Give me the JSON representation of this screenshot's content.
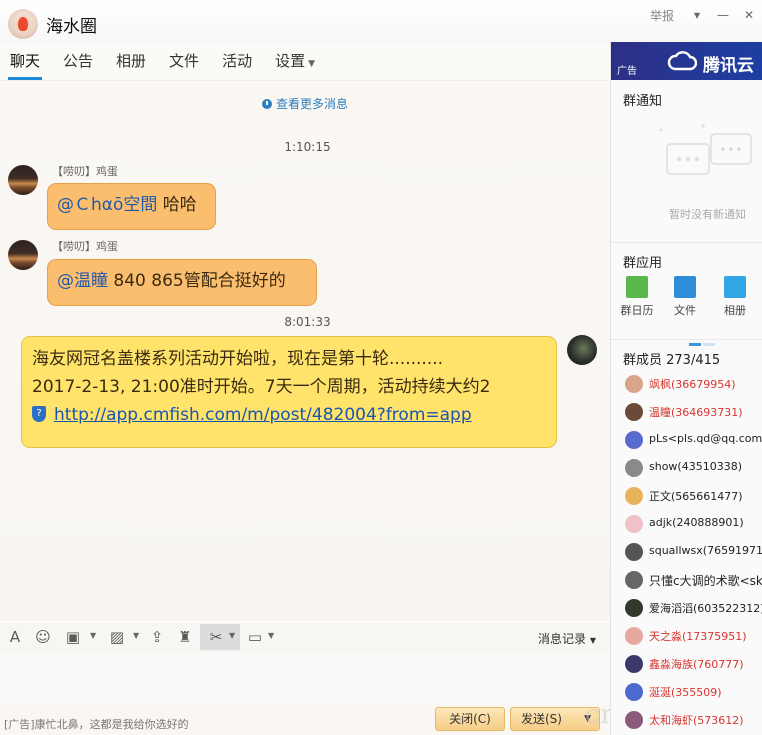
{
  "header": {
    "title": "海水圈",
    "report_label": "举报",
    "minimize_label": "—",
    "close_label": "✕"
  },
  "tabs": [
    {
      "label": "聊天"
    },
    {
      "label": "公告"
    },
    {
      "label": "相册"
    },
    {
      "label": "文件"
    },
    {
      "label": "活动"
    },
    {
      "label": "设置"
    }
  ],
  "chat": {
    "more_messages": "查看更多消息",
    "messages": [
      {
        "time": "1:10:15",
        "sender": "【唠叨】鸡蛋",
        "mention": "@Ｃhαō空間",
        "text": " 哈哈"
      },
      {
        "sender": "【唠叨】鸡蛋",
        "mention": "@温瞳",
        "text": " 840   865管配合挺好的"
      },
      {
        "time": "8:01:33",
        "line1": "海友网冠名盖楼系列活动开始啦，现在是第十轮..........",
        "line2": "2017-2-13, 21:00准时开始。7天一个周期，活动持续大约2",
        "link": "http://app.cmfish.com/m/post/482004?from=app"
      }
    ]
  },
  "toolbar": {
    "history_label": "消息记录"
  },
  "footer": {
    "ad_text": "[广告]康忙北鼻，这都是我给你选好的",
    "close_button": "关闭(C)",
    "send_button": "发送(S)",
    "watermark": "cmfish"
  },
  "right_panel": {
    "ad_label": "广告",
    "ad_brand": "腾讯云",
    "notice_title": "群通知",
    "no_notice": "暂时没有新通知",
    "apps_title": "群应用",
    "apps": [
      {
        "label": "群日历",
        "color": "#58b84a"
      },
      {
        "label": "文件",
        "color": "#2e8cd8"
      },
      {
        "label": "相册",
        "color": "#32a6e6"
      }
    ],
    "members_title": "群成员 273/415",
    "members": [
      {
        "name": "飒枫(36679954)",
        "red": true
      },
      {
        "name": "温瞳(364693731)",
        "red": true
      },
      {
        "name": "pLs<pls.qd@qq.com>",
        "red": false
      },
      {
        "name": "show(43510338)",
        "red": false
      },
      {
        "name": "正文(565661477)",
        "red": false
      },
      {
        "name": "adjk(240888901)",
        "red": false
      },
      {
        "name": "squallwsx(76591971)",
        "red": false
      },
      {
        "name": "只懂c大调的术歌<skd",
        "red": false
      },
      {
        "name": "爱海滔滔(603522312)",
        "red": false
      },
      {
        "name": "天之淼(17375951)",
        "red": true
      },
      {
        "name": "鑫淼海族(760777)",
        "red": true
      },
      {
        "name": "涎涎(355509)",
        "red": true
      },
      {
        "name": "太和海虾(573612)",
        "red": true
      }
    ]
  },
  "colors": {
    "accent": "#1f8ad8",
    "bubble_orange": "#fbbe6e",
    "bubble_yellow": "#ffe36a",
    "ad_banner": "#1c3fa2"
  }
}
